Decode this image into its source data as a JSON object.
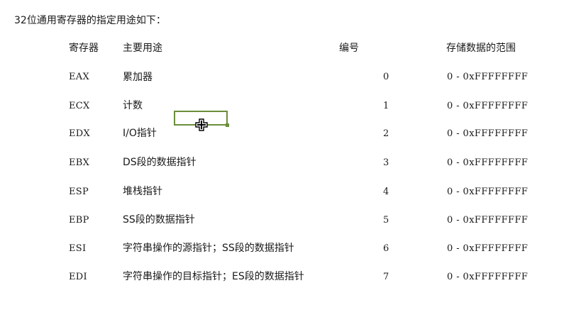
{
  "intro": "32位通用寄存器的指定用途如下：",
  "table": {
    "headers": {
      "name": "寄存器",
      "usage": "主要用途",
      "number": "编号",
      "range": "存储数据的范围"
    },
    "rows": [
      {
        "name": "EAX",
        "usage": "累加器",
        "number": "0",
        "range": "0 - 0xFFFFFFFF"
      },
      {
        "name": "ECX",
        "usage": "计数",
        "number": "1",
        "range": "0 - 0xFFFFFFFF"
      },
      {
        "name": "EDX",
        "usage": "I/O指针",
        "number": "2",
        "range": "0 - 0xFFFFFFFF"
      },
      {
        "name": "EBX",
        "usage": "DS段的数据指针",
        "number": "3",
        "range": "0 - 0xFFFFFFFF"
      },
      {
        "name": "ESP",
        "usage": "堆栈指针",
        "number": "4",
        "range": "0 - 0xFFFFFFFF"
      },
      {
        "name": "EBP",
        "usage": "SS段的数据指针",
        "number": "5",
        "range": "0 - 0xFFFFFFFF"
      },
      {
        "name": "ESI",
        "usage": "字符串操作的源指针；SS段的数据指针",
        "number": "6",
        "range": "0 - 0xFFFFFFFF"
      },
      {
        "name": "EDI",
        "usage": "字符串操作的目标指针；ES段的数据指针",
        "number": "7",
        "range": "0 - 0xFFFFFFFF"
      }
    ]
  },
  "colors": {
    "selection": "#6b8e3a",
    "text": "#1a1a1a"
  },
  "cursor": {
    "icon": "move-cross-cursor-icon"
  }
}
